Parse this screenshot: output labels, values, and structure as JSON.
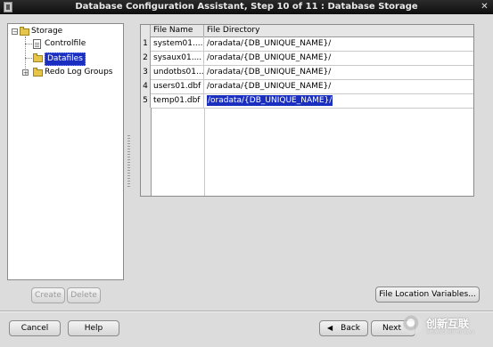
{
  "window": {
    "title": "Database Configuration Assistant, Step 10 of 11 : Database Storage",
    "close_glyph": "✕"
  },
  "tree": {
    "root": {
      "label": "Storage",
      "expander": "−"
    },
    "items": [
      {
        "label": "Controlfile",
        "icon": "document-icon"
      },
      {
        "label": "Datafiles",
        "icon": "folder-icon",
        "selected": true
      },
      {
        "label": "Redo Log Groups",
        "icon": "folder-icon",
        "expander": "+"
      }
    ]
  },
  "table": {
    "columns": [
      "File Name",
      "File Directory"
    ],
    "rows": [
      {
        "num": "1",
        "name": "system01....",
        "dir": "/oradata/{DB_UNIQUE_NAME}/"
      },
      {
        "num": "2",
        "name": "sysaux01....",
        "dir": "/oradata/{DB_UNIQUE_NAME}/"
      },
      {
        "num": "3",
        "name": "undotbs01....",
        "dir": "/oradata/{DB_UNIQUE_NAME}/"
      },
      {
        "num": "4",
        "name": "users01.dbf",
        "dir": "/oradata/{DB_UNIQUE_NAME}/"
      },
      {
        "num": "5",
        "name": "temp01.dbf",
        "dir": "/oradata/{DB_UNIQUE_NAME}/",
        "selected": true
      }
    ]
  },
  "buttons": {
    "create": "Create",
    "delete": "Delete",
    "file_location_variables": "File Location Variables...",
    "cancel": "Cancel",
    "help": "Help",
    "back": "Back",
    "next": "Next"
  },
  "watermark": {
    "text": "创新互联",
    "sub": "CHUANG XIN HU LIAN"
  }
}
